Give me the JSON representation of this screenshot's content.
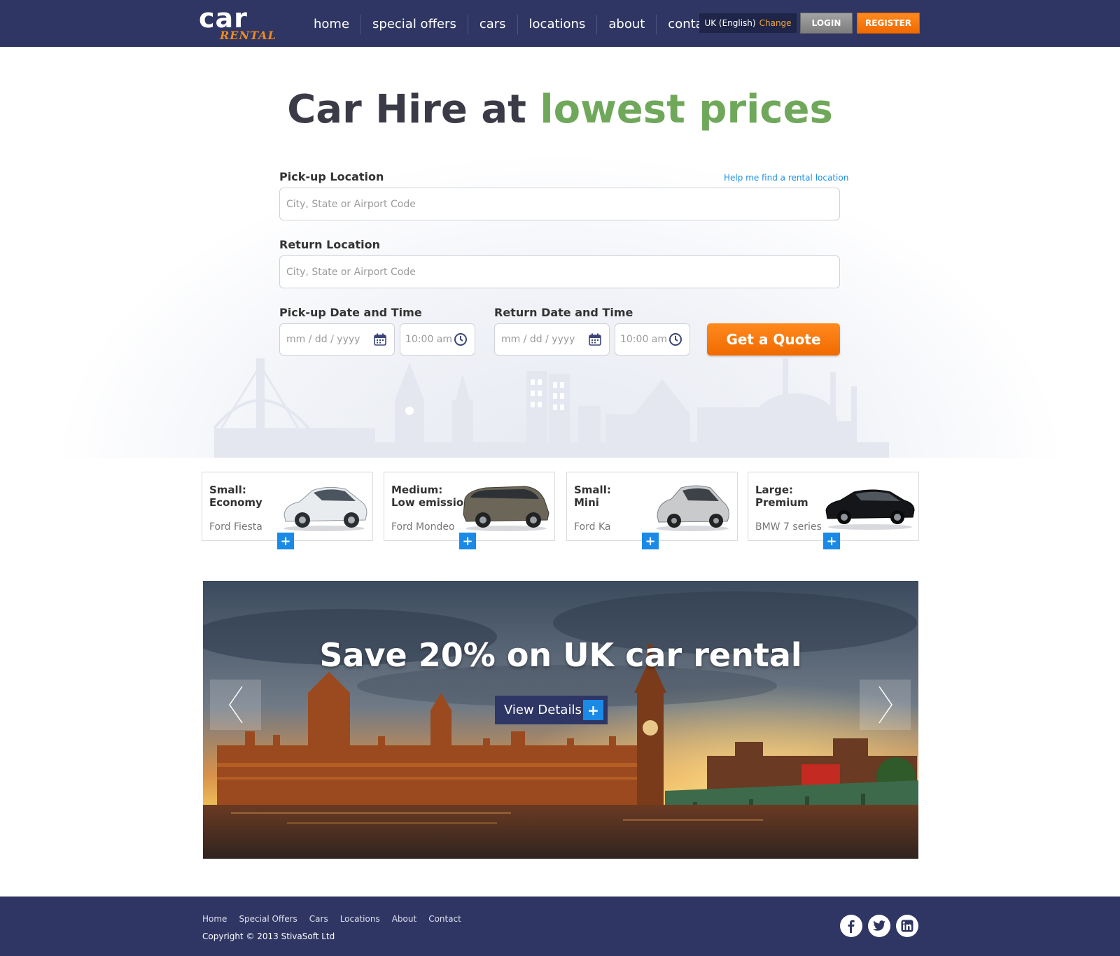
{
  "header": {
    "logo_top": "car",
    "logo_bottom": "RENTAL",
    "nav": [
      "home",
      "special offers",
      "cars",
      "locations",
      "about",
      "contact"
    ],
    "language": "UK (English)",
    "language_change": "Change",
    "login": "LOGIN",
    "register": "REGISTER"
  },
  "hero": {
    "title_start": "Car Hire at ",
    "title_accent": "lowest prices",
    "pickup_location_label": "Pick-up Location",
    "help_link": "Help me find a rental location",
    "pickup_location_placeholder": "City, State or Airport Code",
    "return_location_label": "Return Location",
    "return_location_placeholder": "City, State or Airport Code",
    "pickup_datetime_label": "Pick-up Date and Time",
    "return_datetime_label": "Return Date and Time",
    "date_placeholder": "mm / dd / yyyy",
    "time_value": "10:00 am",
    "quote_button": "Get a Quote"
  },
  "cars": [
    {
      "category_line1": "Small:",
      "category_line2": "Economy",
      "model": "Ford Fiesta",
      "color": "#e9ecef"
    },
    {
      "category_line1": "Medium:",
      "category_line2": "Low emission",
      "model": "Ford Mondeo",
      "color": "#6b6657"
    },
    {
      "category_line1": "Small:",
      "category_line2": "Mini",
      "model": "Ford Ka",
      "color": "#c8cacc"
    },
    {
      "category_line1": "Large:",
      "category_line2": "Premium",
      "model": "BMW 7 series",
      "color": "#15161a"
    }
  ],
  "banner": {
    "title": "Save 20% on UK car rental",
    "details_button": "View Details"
  },
  "footer": {
    "links": [
      "Home",
      "Special Offers",
      "Cars",
      "Locations",
      "About",
      "Contact"
    ],
    "copyright": "Copyright © 2013 StivaSoft Ltd",
    "social": [
      "facebook-icon",
      "twitter-icon",
      "linkedin-icon"
    ]
  },
  "colors": {
    "header_bg": "#2f3663",
    "accent_orange": "#f06a00",
    "accent_green": "#6fa85a",
    "accent_blue": "#1a8ae6"
  }
}
